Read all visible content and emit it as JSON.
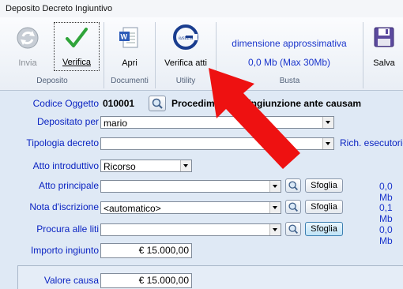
{
  "window": {
    "title": "Deposito Decreto Ingiuntivo"
  },
  "ribbon": {
    "invia_label": "Invia",
    "verifica_label": "Verifica",
    "apri_label": "Apri",
    "verifica_atti_label": "Verifica atti",
    "salva_label": "Salva",
    "logo_text": "iustizia",
    "group_deposito": "Deposito",
    "group_documenti": "Documenti",
    "group_utility": "Utility",
    "group_busta": "Busta",
    "dimensione_label": "dimensione approssimativa",
    "dimensione_value": "0,0 Mb (Max 30Mb)"
  },
  "form": {
    "codice_oggetto_label": "Codice Oggetto",
    "codice_oggetto_value": "010001",
    "procedimento_text": "Procedimento di ingiunzione ante causam",
    "depositato_per_label": "Depositato per",
    "depositato_per_value": "mario",
    "tipologia_label": "Tipologia decreto",
    "tipologia_value": "",
    "rich_esecutorieta": "Rich. esecutorietà",
    "atto_introduttivo_label": "Atto introduttivo",
    "atto_introduttivo_value": "Ricorso",
    "atto_principale_label": "Atto principale",
    "atto_principale_value": "",
    "nota_label": "Nota d'iscrizione",
    "nota_value": "<automatico>",
    "procura_label": "Procura alle liti",
    "procura_value": "",
    "sfoglia_label": "Sfoglia",
    "size_atto": "0,0 Mb",
    "size_nota": "0,1 Mb",
    "size_procura": "0,0 Mb",
    "importo_label": "Importo ingiunto",
    "importo_value": "€ 15.000,00",
    "valore_causa_label": "Valore causa",
    "valore_causa_value": "€ 15.000,00"
  }
}
